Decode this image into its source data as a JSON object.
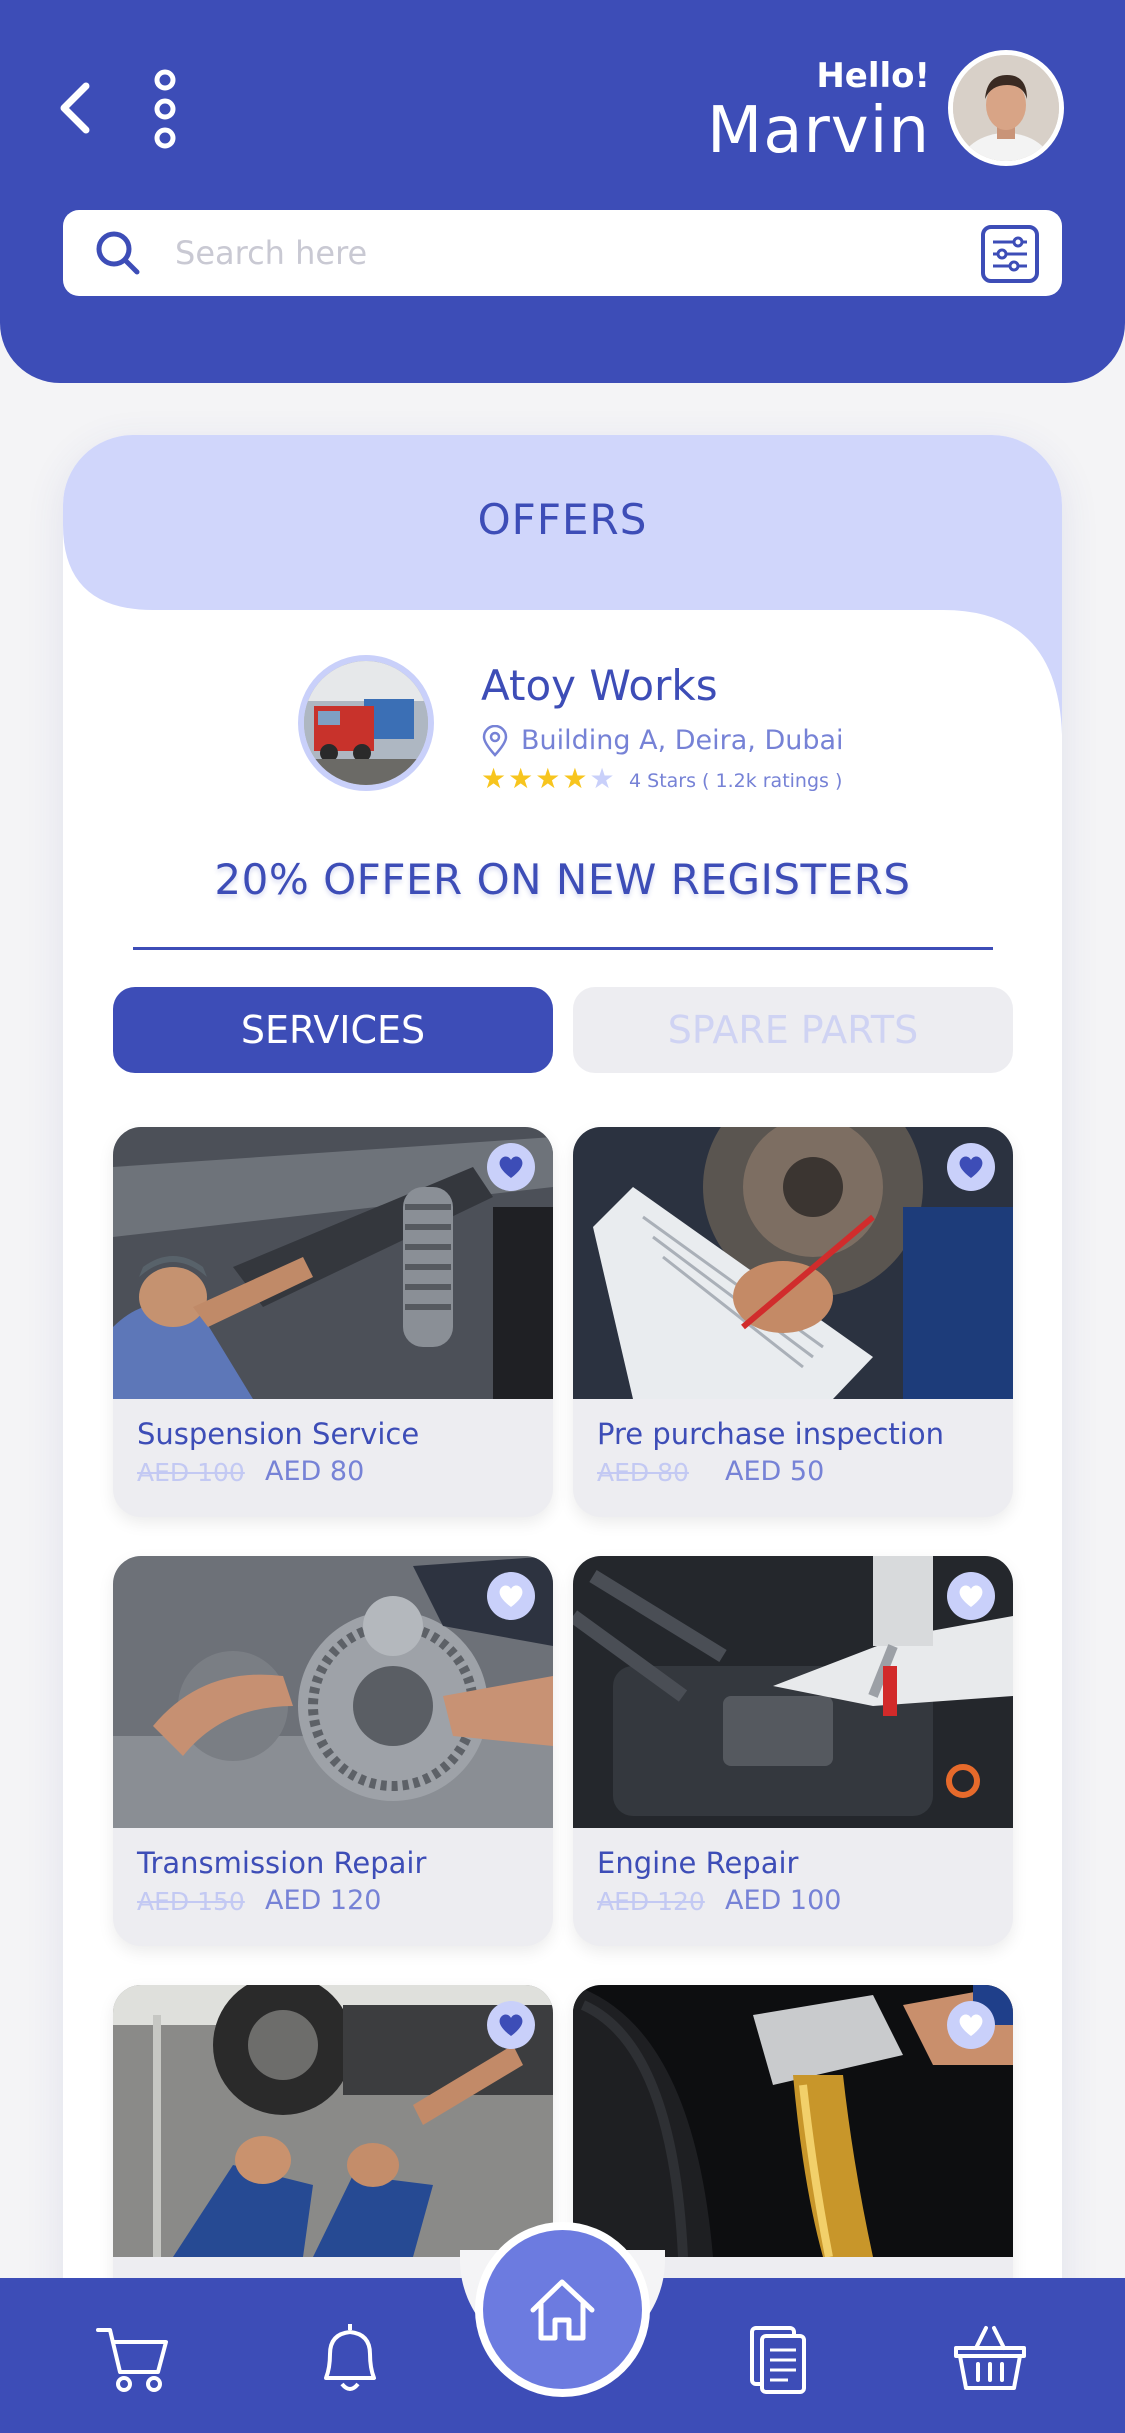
{
  "header": {
    "greeting": "Hello!",
    "username": "Marvin"
  },
  "search": {
    "placeholder": "Search here",
    "value": ""
  },
  "offers": {
    "title": "OFFERS",
    "shop": {
      "name": "Atoy Works",
      "address": "Building A, Deira, Dubai",
      "rating": 4,
      "max_rating": 5,
      "rating_text": "4 Stars ( 1.2k ratings )"
    },
    "promo": "20% OFFER ON NEW REGISTERS"
  },
  "tabs": [
    {
      "label": "SERVICES",
      "active": true
    },
    {
      "label": "SPARE PARTS",
      "active": false
    }
  ],
  "services": [
    {
      "name": "Suspension Service",
      "old_price": "AED 100",
      "price": "AED 80",
      "favorite": true
    },
    {
      "name": "Pre purchase inspection",
      "old_price": "AED 80",
      "price": "AED 50",
      "favorite": true
    },
    {
      "name": "Transmission Repair",
      "old_price": "AED 150",
      "price": "AED 120",
      "favorite": false
    },
    {
      "name": "Engine Repair",
      "old_price": "AED 120",
      "price": "AED 100",
      "favorite": false
    },
    {
      "name": "",
      "old_price": "",
      "price": "",
      "favorite": true
    },
    {
      "name": "",
      "old_price": "",
      "price": "",
      "favorite": false
    }
  ],
  "bottom_nav": [
    "cart-icon",
    "bell-icon",
    "home-icon",
    "documents-icon",
    "basket-icon"
  ],
  "colors": {
    "primary": "#3d4db7",
    "accent_light": "#c9d0fa",
    "star": "#f7c51e",
    "muted": "#ededf1"
  }
}
